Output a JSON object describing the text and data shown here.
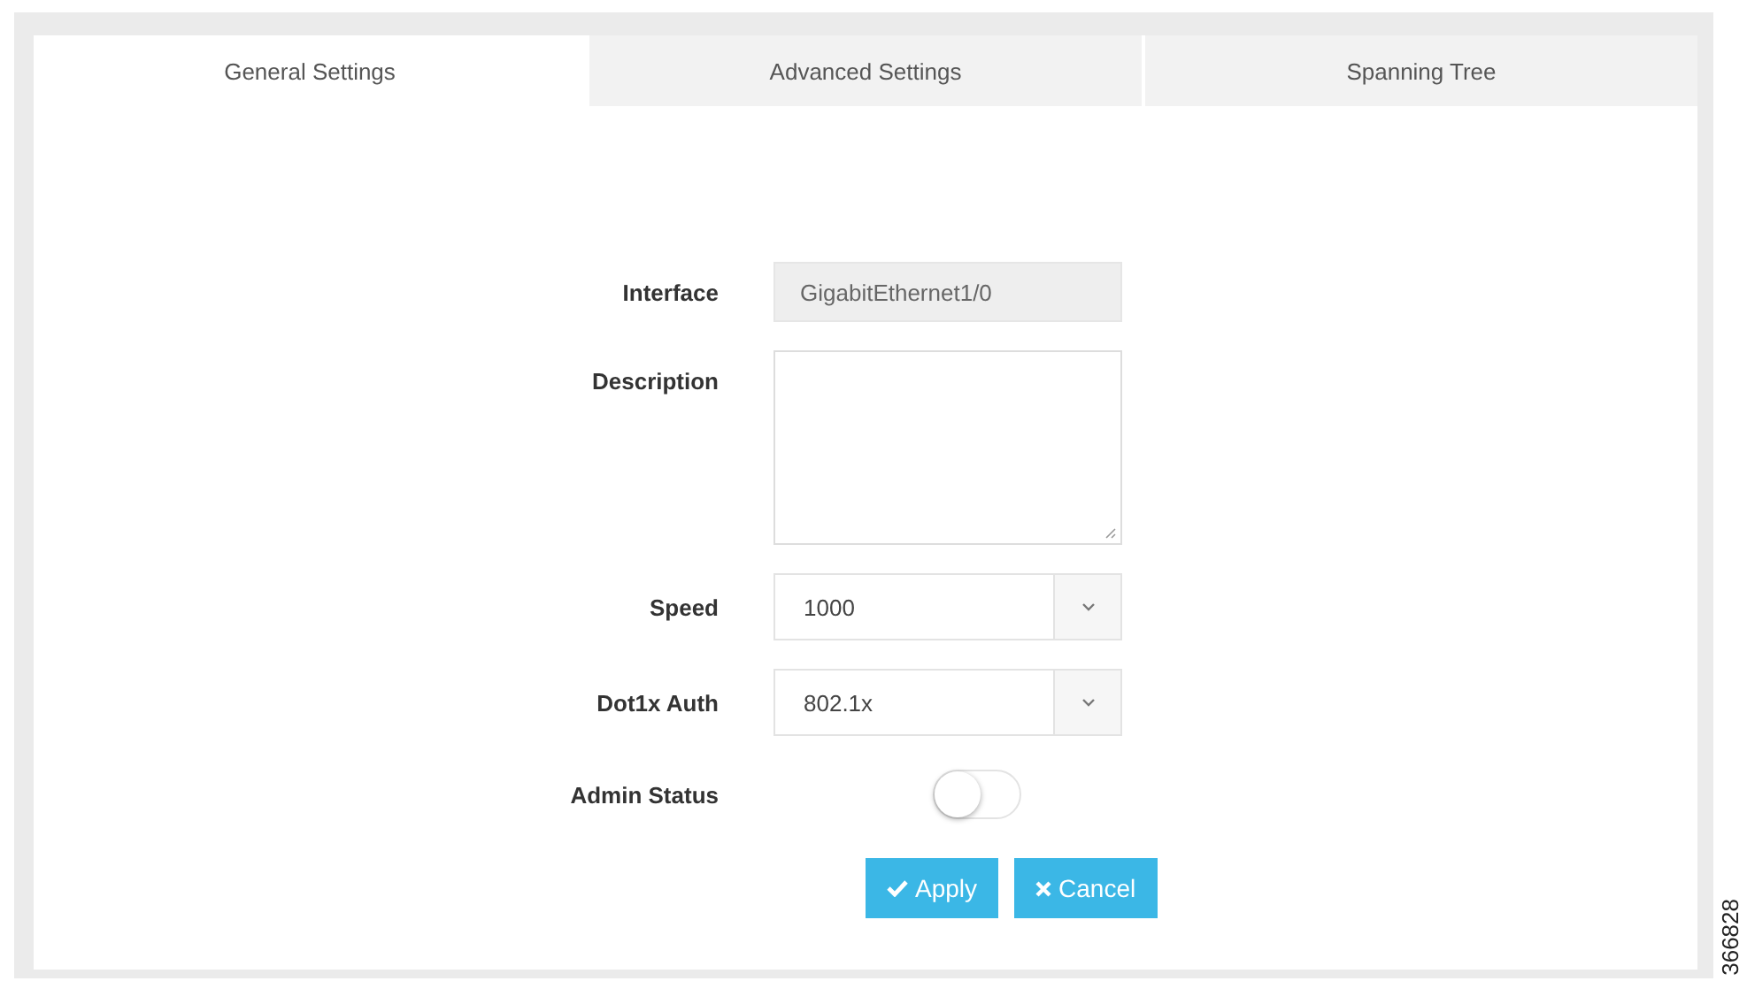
{
  "tabs": [
    {
      "label": "General Settings",
      "selected": true
    },
    {
      "label": "Advanced Settings",
      "selected": false
    },
    {
      "label": "Spanning Tree",
      "selected": false
    }
  ],
  "form": {
    "fields": [
      {
        "kind": "readonly",
        "label": "Interface",
        "value": "GigabitEthernet1/0"
      },
      {
        "kind": "textarea",
        "label": "Description"
      },
      {
        "kind": "select",
        "label": "Speed",
        "value": "1000"
      },
      {
        "kind": "select",
        "label": "Dot1x Auth",
        "value": "802.1x"
      },
      {
        "kind": "toggle",
        "label": "Admin Status",
        "on": false
      }
    ]
  },
  "buttons": [
    {
      "kind": "apply",
      "label": "Apply"
    },
    {
      "kind": "cancel",
      "label": "Cancel"
    }
  ],
  "figure_number": "366828"
}
